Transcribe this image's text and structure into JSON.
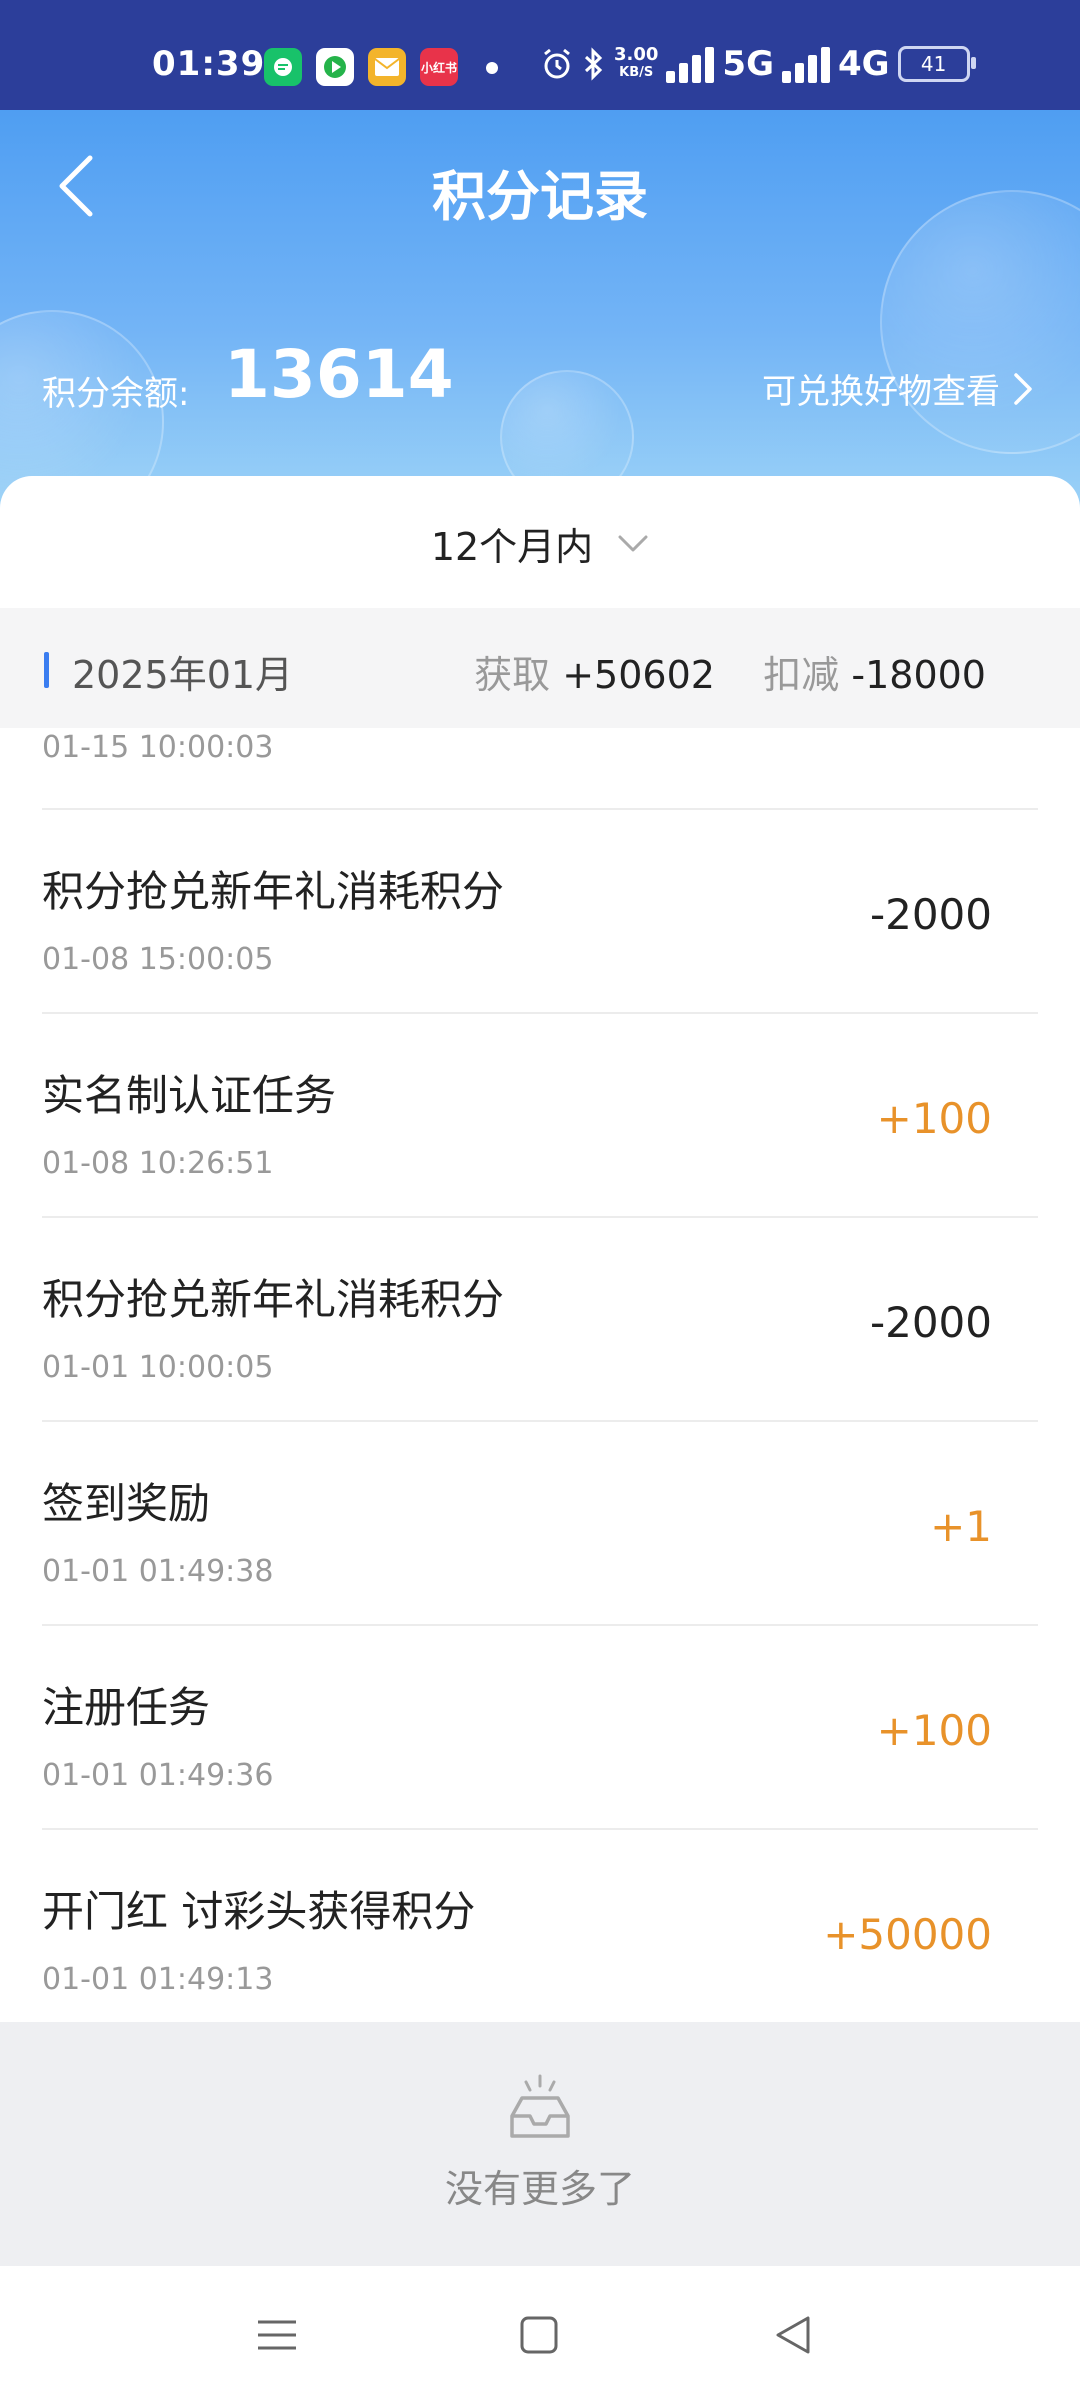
{
  "status_bar": {
    "time": "01:39",
    "net_speed_value": "3.00",
    "net_speed_unit": "KB/S",
    "network_1": "5G",
    "network_2": "4G",
    "battery": "41",
    "notif_red_label": "小红书"
  },
  "header": {
    "title": "积分记录",
    "balance_label": "积分余额:",
    "balance_value": "13614",
    "exchange_link": "可兑换好物查看"
  },
  "filter": {
    "label": "12个月内"
  },
  "month": {
    "label": "2025年01月",
    "gain_label": "获取",
    "gain_value": "+50602",
    "deduct_label": "扣减",
    "deduct_value": "-18000"
  },
  "partial_record_time": "01-15 10:00:03",
  "records": [
    {
      "title": "积分抢兑新年礼消耗积分",
      "time": "01-08 15:00:05",
      "amount": "-2000",
      "type": "minus"
    },
    {
      "title": "实名制认证任务",
      "time": "01-08 10:26:51",
      "amount": "+100",
      "type": "plus"
    },
    {
      "title": "积分抢兑新年礼消耗积分",
      "time": "01-01 10:00:05",
      "amount": "-2000",
      "type": "minus"
    },
    {
      "title": "签到奖励",
      "time": "01-01 01:49:38",
      "amount": "+1",
      "type": "plus"
    },
    {
      "title": "注册任务",
      "time": "01-01 01:49:36",
      "amount": "+100",
      "type": "plus"
    },
    {
      "title": "开门红 讨彩头获得积分",
      "time": "01-01 01:49:13",
      "amount": "+50000",
      "type": "plus"
    }
  ],
  "empty_text": "没有更多了",
  "colors": {
    "status_bar": "#2c3e9a",
    "header_top": "#4f9ef2",
    "accent_blue": "#3a7df0",
    "plus_amount": "#e8922a"
  },
  "icons": {
    "back": "chevron-left-icon",
    "exchange": "chevron-right-icon",
    "filter": "chevron-down-icon",
    "empty": "empty-box-icon",
    "nav_menu": "menu-icon",
    "nav_home": "home-square-icon",
    "nav_back": "back-triangle-icon"
  }
}
